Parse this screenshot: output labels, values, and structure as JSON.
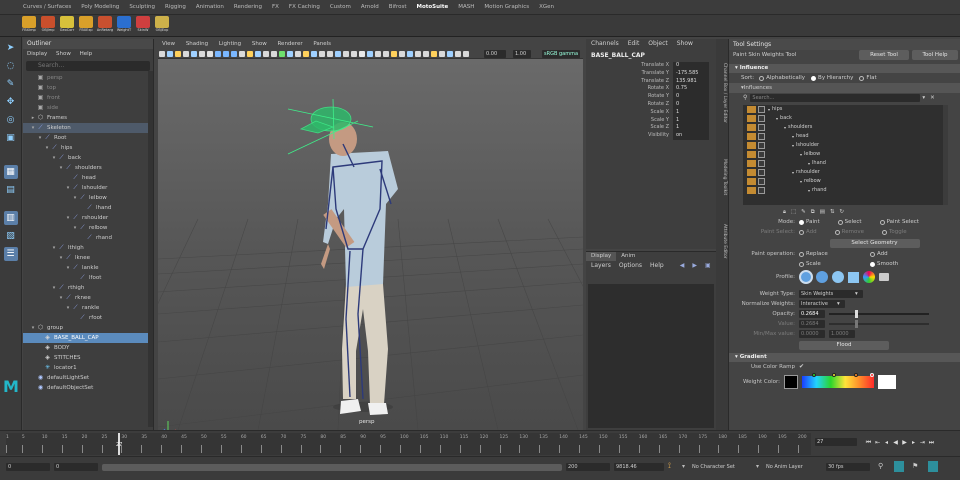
{
  "shelf": {
    "tabs": [
      "Curves / Surfaces",
      "Poly Modeling",
      "Sculpting",
      "Rigging",
      "Animation",
      "Rendering",
      "FX",
      "FX Caching",
      "Custom",
      "Arnold",
      "Bifrost",
      "MotoSuite",
      "MASH",
      "Motion Graphics",
      "XGen"
    ],
    "active_tab": "MotoSuite",
    "icons": [
      {
        "label": "FBXImp",
        "color": "#d9a02a"
      },
      {
        "label": "OBJImp",
        "color": "#c94f2c"
      },
      {
        "label": "GeoCorr",
        "color": "#d7c03b"
      },
      {
        "label": "FBXExp",
        "color": "#d9a02a"
      },
      {
        "label": "AnRetarg",
        "color": "#c9502f"
      },
      {
        "label": "WeightT",
        "color": "#2b6fd0"
      },
      {
        "label": "SkinW",
        "color": "#cf3f3f"
      },
      {
        "label": "OBJExp",
        "color": "#cdb14a"
      }
    ]
  },
  "outliner": {
    "title": "Outliner",
    "menu": [
      "Display",
      "Show",
      "Help"
    ],
    "search_placeholder": "Search...",
    "rows": [
      {
        "label": "persp",
        "indent": 1,
        "icon": "camera-icon",
        "dim": true
      },
      {
        "label": "top",
        "indent": 1,
        "icon": "camera-icon",
        "dim": true
      },
      {
        "label": "front",
        "indent": 1,
        "icon": "camera-icon",
        "dim": true
      },
      {
        "label": "side",
        "indent": 1,
        "icon": "camera-icon",
        "dim": true
      },
      {
        "label": "Frames",
        "indent": 1,
        "icon": "group-icon",
        "caret": "+"
      },
      {
        "label": "Skeleton",
        "indent": 1,
        "icon": "joint-icon",
        "caret": "-",
        "highlight": true
      },
      {
        "label": "Root",
        "indent": 2,
        "icon": "joint-icon",
        "caret": "-"
      },
      {
        "label": "hips",
        "indent": 3,
        "icon": "joint-icon",
        "caret": "-"
      },
      {
        "label": "back",
        "indent": 4,
        "icon": "joint-icon",
        "caret": "-"
      },
      {
        "label": "shoulders",
        "indent": 5,
        "icon": "joint-icon",
        "caret": "-"
      },
      {
        "label": "head",
        "indent": 6,
        "icon": "joint-icon"
      },
      {
        "label": "lshoulder",
        "indent": 6,
        "icon": "joint-icon",
        "caret": "-"
      },
      {
        "label": "lelbow",
        "indent": 7,
        "icon": "joint-icon",
        "caret": "-"
      },
      {
        "label": "lhand",
        "indent": 8,
        "icon": "joint-icon"
      },
      {
        "label": "rshoulder",
        "indent": 6,
        "icon": "joint-icon",
        "caret": "-"
      },
      {
        "label": "relbow",
        "indent": 7,
        "icon": "joint-icon",
        "caret": "-"
      },
      {
        "label": "rhand",
        "indent": 8,
        "icon": "joint-icon"
      },
      {
        "label": "lthigh",
        "indent": 4,
        "icon": "joint-icon",
        "caret": "-"
      },
      {
        "label": "lknee",
        "indent": 5,
        "icon": "joint-icon",
        "caret": "-"
      },
      {
        "label": "lankle",
        "indent": 6,
        "icon": "joint-icon",
        "caret": "-"
      },
      {
        "label": "lfoot",
        "indent": 7,
        "icon": "joint-icon"
      },
      {
        "label": "rthigh",
        "indent": 4,
        "icon": "joint-icon",
        "caret": "-"
      },
      {
        "label": "rknee",
        "indent": 5,
        "icon": "joint-icon",
        "caret": "-"
      },
      {
        "label": "rankle",
        "indent": 6,
        "icon": "joint-icon",
        "caret": "-"
      },
      {
        "label": "rfoot",
        "indent": 7,
        "icon": "joint-icon"
      },
      {
        "label": "group",
        "indent": 1,
        "icon": "group-icon",
        "caret": "-"
      },
      {
        "label": "BASE_BALL_CAP",
        "indent": 2,
        "icon": "mesh-icon",
        "selected": true
      },
      {
        "label": "BODY",
        "indent": 2,
        "icon": "mesh-icon"
      },
      {
        "label": "STITCHES",
        "indent": 2,
        "icon": "mesh-icon"
      },
      {
        "label": "locator1",
        "indent": 2,
        "icon": "locator-icon"
      },
      {
        "label": "defaultLightSet",
        "indent": 1,
        "icon": "set-icon"
      },
      {
        "label": "defaultObjectSet",
        "indent": 1,
        "icon": "set-icon"
      }
    ]
  },
  "viewport": {
    "menu": [
      "View",
      "Shading",
      "Lighting",
      "Show",
      "Renderer",
      "Panels"
    ],
    "field_a": "0.00",
    "field_b": "1.00",
    "colorspace": "sRGB gamma",
    "camera_label": "persp"
  },
  "channelbox": {
    "menu": [
      "Channels",
      "Edit",
      "Object",
      "Show"
    ],
    "object_name": "BASE_BALL_CAP",
    "channels": [
      {
        "name": "Translate X",
        "value": "0"
      },
      {
        "name": "Translate Y",
        "value": "-175.585"
      },
      {
        "name": "Translate Z",
        "value": "135.981"
      },
      {
        "name": "Rotate X",
        "value": "0.75"
      },
      {
        "name": "Rotate Y",
        "value": "0"
      },
      {
        "name": "Rotate Z",
        "value": "0"
      },
      {
        "name": "Scale X",
        "value": "1"
      },
      {
        "name": "Scale Y",
        "value": "1"
      },
      {
        "name": "Scale Z",
        "value": "1"
      },
      {
        "name": "Visibility",
        "value": "on"
      }
    ]
  },
  "layers": {
    "tabs": [
      "Display",
      "Anim"
    ],
    "menu": [
      "Layers",
      "Options",
      "Help"
    ]
  },
  "side_tabs": [
    "Channel Box / Layer Editor",
    "Modeling Toolkit",
    "Attribute Editor"
  ],
  "toolsettings": {
    "title": "Tool Settings",
    "tool_name": "Paint Skin Weights Tool",
    "reset_label": "Reset Tool",
    "help_label": "Tool Help",
    "section_influence": "Influence",
    "sort_label": "Sort:",
    "sort_options": [
      "Alphabetically",
      "By Hierarchy",
      "Flat"
    ],
    "sort_selected": 1,
    "influences_label": "Influences",
    "search_placeholder": "Search...",
    "influences": [
      {
        "label": "hips",
        "indent": 0
      },
      {
        "label": "back",
        "indent": 1
      },
      {
        "label": "shoulders",
        "indent": 2
      },
      {
        "label": "head",
        "indent": 3
      },
      {
        "label": "lshoulder",
        "indent": 3
      },
      {
        "label": "lelbow",
        "indent": 4
      },
      {
        "label": "lhand",
        "indent": 5
      },
      {
        "label": "rshoulder",
        "indent": 3
      },
      {
        "label": "relbow",
        "indent": 4
      },
      {
        "label": "rhand",
        "indent": 5
      }
    ],
    "mode_label": "Mode:",
    "mode_options": [
      "Paint",
      "Select",
      "Paint Select"
    ],
    "mode_selected": 0,
    "paint_select_label": "Paint Select:",
    "paint_select_options": [
      "Add",
      "Remove",
      "Toggle"
    ],
    "select_geometry_label": "Select Geometry",
    "paint_ops_label": "Paint operation:",
    "paint_ops": [
      "Replace",
      "Add",
      "Scale",
      "Smooth"
    ],
    "paint_ops_selected": 3,
    "profile_label": "Profile:",
    "weight_type_label": "Weight Type:",
    "weight_type_value": "Skin Weights",
    "normalize_label": "Normalize Weights:",
    "normalize_value": "Interactive",
    "opacity_label": "Opacity:",
    "opacity_value": "0.2684",
    "opacity_fraction": 0.27,
    "value_label": "Value:",
    "value_value": "0.2684",
    "value_fraction": 0.27,
    "minmax_label": "Min/Max value:",
    "min_value": "0.0000",
    "max_value": "1.0000",
    "flood_label": "Flood",
    "section_gradient": "Gradient",
    "use_color_ramp_label": "Use Color Ramp",
    "weight_color_label": "Weight Color:"
  },
  "timeline": {
    "ticks": [
      "1",
      "5",
      "10",
      "15",
      "20",
      "25",
      "30",
      "35",
      "40",
      "45",
      "50",
      "55",
      "60",
      "65",
      "70",
      "75",
      "80",
      "85",
      "90",
      "95",
      "100",
      "105",
      "110",
      "115",
      "120",
      "125",
      "130",
      "135",
      "140",
      "145",
      "150",
      "155",
      "160",
      "165",
      "170",
      "175",
      "180",
      "185",
      "190",
      "195",
      "200"
    ],
    "current_frame": "27",
    "current_frame_field": "27",
    "range_start": "0",
    "playback_start": "0",
    "playback_end": "200",
    "range_end_field": "9818.46",
    "character_set": "No Character Set",
    "anim_layer": "No Anim Layer",
    "fps": "30 fps"
  },
  "colors": {
    "accent": "#5b8bbd",
    "selection_green": "#3fef8a",
    "influence_tag": "#c48b32"
  }
}
